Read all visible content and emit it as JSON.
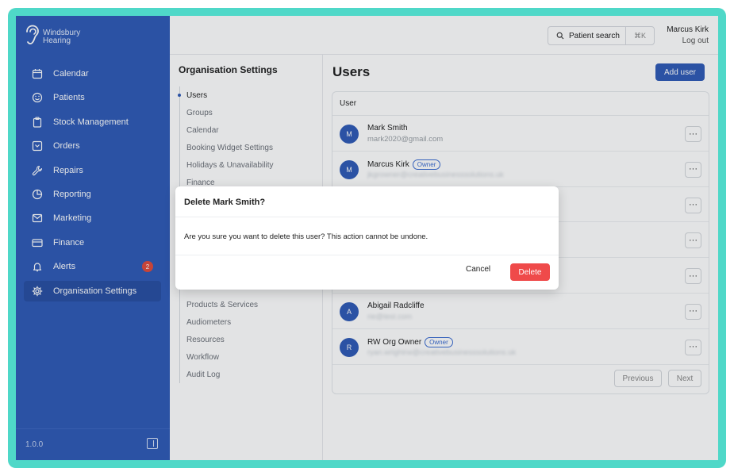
{
  "brand": {
    "line1": "Windsbury",
    "line2": "Hearing",
    "logo_icon": "ear-icon"
  },
  "sidebar": {
    "items": [
      {
        "label": "Calendar",
        "icon": "calendar-icon"
      },
      {
        "label": "Patients",
        "icon": "smiley-icon"
      },
      {
        "label": "Stock Management",
        "icon": "clipboard-icon"
      },
      {
        "label": "Orders",
        "icon": "inbox-icon"
      },
      {
        "label": "Repairs",
        "icon": "wrench-icon"
      },
      {
        "label": "Reporting",
        "icon": "pie-chart-icon"
      },
      {
        "label": "Marketing",
        "icon": "mail-icon"
      },
      {
        "label": "Finance",
        "icon": "credit-card-icon"
      },
      {
        "label": "Alerts",
        "icon": "bell-icon",
        "badge": "2"
      },
      {
        "label": "Organisation Settings",
        "icon": "gear-icon",
        "active": true
      }
    ],
    "version": "1.0.0"
  },
  "header": {
    "search_label": "Patient search",
    "search_shortcut": "⌘K",
    "user_name": "Marcus Kirk",
    "logout_label": "Log out"
  },
  "settings_nav": {
    "title": "Organisation Settings",
    "items_top": [
      "Users",
      "Groups",
      "Calendar",
      "Booking Widget Settings",
      "Holidays & Unavailability",
      "Finance"
    ],
    "items_bottom": [
      "Products & Services",
      "Audiometers",
      "Resources",
      "Workflow",
      "Audit Log"
    ]
  },
  "main": {
    "title": "Users",
    "add_user_label": "Add user",
    "column_header": "User",
    "owner_badge": "Owner",
    "users": [
      {
        "initial": "M",
        "name": "Mark Smith",
        "email": "mark2020@gmail.com"
      },
      {
        "initial": "M",
        "name": "Marcus Kirk",
        "email": "jkgrowner@creativebusinesssolutions.uk",
        "owner": true
      },
      {
        "initial": "",
        "name": "",
        "email": ""
      },
      {
        "initial": "",
        "name": "",
        "email": ""
      },
      {
        "initial": "",
        "name": "",
        "email": ""
      },
      {
        "initial": "A",
        "name": "Abigail Radcliffe",
        "email": "rie@test.com"
      },
      {
        "initial": "R",
        "name": "RW Org Owner",
        "email": "ryan.wrightrw@creativebusinesssolutions.uk",
        "owner": true
      }
    ],
    "prev_label": "Previous",
    "next_label": "Next"
  },
  "modal": {
    "title": "Delete Mark Smith?",
    "body": "Are you sure you want to delete this user? This action cannot be undone.",
    "cancel_label": "Cancel",
    "delete_label": "Delete"
  },
  "colors": {
    "sidebar": "#2f5bb7",
    "accent": "#2f5bb7",
    "danger": "#ef4a4a",
    "frame": "#4fd8c8"
  }
}
